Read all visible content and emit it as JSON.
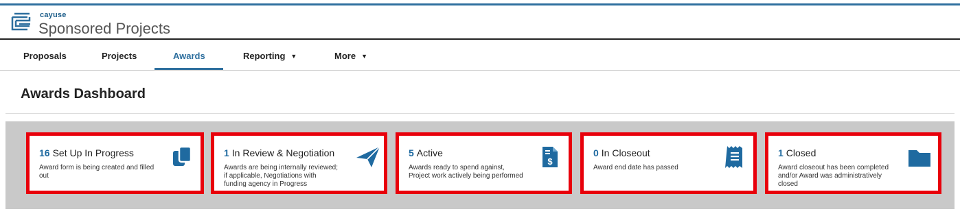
{
  "header": {
    "brand_small": "cayuse",
    "brand_big": "Sponsored Projects"
  },
  "nav": {
    "items": [
      {
        "label": "Proposals"
      },
      {
        "label": "Projects"
      },
      {
        "label": "Awards",
        "active": true
      },
      {
        "label": "Reporting",
        "dropdown": true
      },
      {
        "label": "More",
        "dropdown": true
      }
    ],
    "caret": "▼"
  },
  "page": {
    "title": "Awards Dashboard"
  },
  "cards": [
    {
      "count": "16",
      "title": "Set Up In Progress",
      "desc_lines": [
        "Award form is being created and filled",
        "out"
      ],
      "icon": "copy-icon"
    },
    {
      "count": "1",
      "title": "In Review & Negotiation",
      "desc_lines": [
        "Awards are being internally reviewed;",
        "if applicable, Negotiations with",
        "funding agency in Progress"
      ],
      "icon": "paper-plane-icon"
    },
    {
      "count": "5",
      "title": "Active",
      "desc_lines": [
        "Awards ready to spend against,",
        "Project work actively being performed"
      ],
      "icon": "invoice-dollar-icon"
    },
    {
      "count": "0",
      "title": "In Closeout",
      "desc_lines": [
        "Award end date has passed"
      ],
      "icon": "receipt-icon"
    },
    {
      "count": "1",
      "title": "Closed",
      "desc_lines": [
        "Award closeout has been completed",
        "and/or Award was administratively",
        "closed"
      ],
      "icon": "folder-icon"
    }
  ],
  "colors": {
    "accent": "#2e6f9e",
    "count": "#1f6aa0",
    "highlight_border": "#e8000b",
    "panel": "#c9c9c9"
  }
}
